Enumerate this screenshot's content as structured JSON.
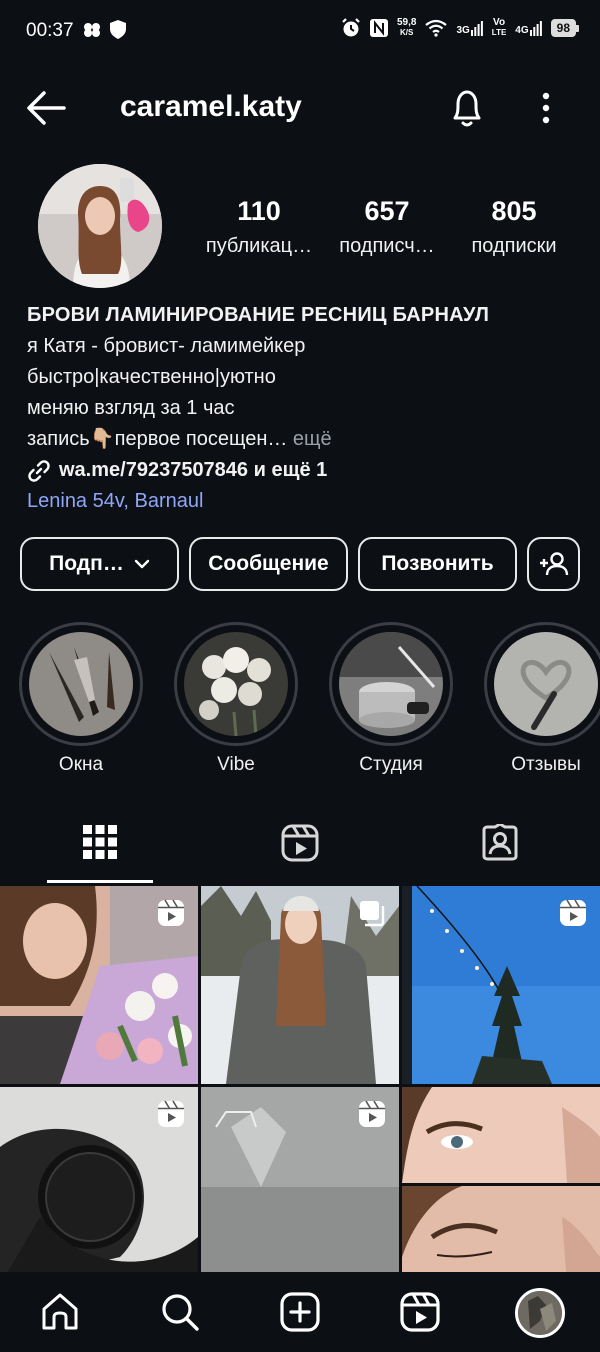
{
  "status_bar": {
    "time": "00:37",
    "net_speed_top": "59,8",
    "net_speed_bottom": "K/S",
    "net1": "3G",
    "volte_top": "Vo",
    "volte_bottom": "LTE",
    "net2": "4G",
    "battery": "98"
  },
  "header": {
    "username": "caramel.katy"
  },
  "stats": [
    {
      "value": "110",
      "label": "публикац…"
    },
    {
      "value": "657",
      "label": "подписч…"
    },
    {
      "value": "805",
      "label": "подписки"
    }
  ],
  "bio": {
    "title": "БРОВИ  ЛАМИНИРОВАНИЕ РЕСНИЦ  БАРНАУЛ",
    "line1": "я Катя - бровист- ламимейкер",
    "line2": "быстро|качественно|уютно",
    "line3": "меняю взгляд за 1 час",
    "line4": "запись👇🏼первое посещен…",
    "more": " ещё",
    "link": "wa.me/79237507846 и ещё 1",
    "location": "Lenina 54v, Barnaul"
  },
  "buttons": {
    "follow": "Подп…",
    "message": "Сообщение",
    "call": "Позвонить"
  },
  "highlights": [
    {
      "label": "Окна"
    },
    {
      "label": "Vibe"
    },
    {
      "label": "Студия"
    },
    {
      "label": "Отзывы"
    }
  ],
  "colors": {
    "background": "#0c0f14",
    "link_blue": "#8fa7f5",
    "muted": "#9aa0a6"
  }
}
